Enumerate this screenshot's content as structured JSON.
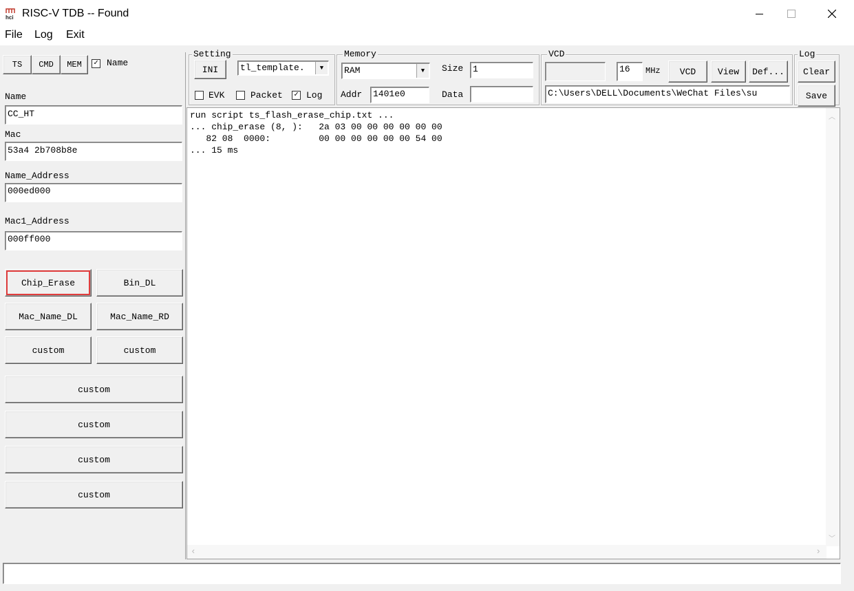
{
  "window": {
    "title": "RISC-V TDB -- Found",
    "app_icon_text": "hci"
  },
  "menu": {
    "file": "File",
    "log": "Log",
    "exit": "Exit"
  },
  "left": {
    "tabs": {
      "ts": "TS",
      "cmd": "CMD",
      "mem": "MEM"
    },
    "name_check_label": "Name",
    "name_label": "Name",
    "name_value": "CC_HT",
    "mac_label": "Mac",
    "mac_value": "53a4 2b708b8e",
    "name_address_label": "Name_Address",
    "name_address_value": "000ed000",
    "mac1_address_label": "Mac1_Address",
    "mac1_address_value": "000ff000",
    "buttons": {
      "chip_erase": "Chip_Erase",
      "bin_dl": "Bin_DL",
      "mac_name_dl": "Mac_Name_DL",
      "mac_name_rd": "Mac_Name_RD",
      "custom_1": "custom",
      "custom_2": "custom",
      "custom_3": "custom",
      "custom_4": "custom",
      "custom_5": "custom",
      "custom_6": "custom"
    }
  },
  "setting": {
    "title": "Setting",
    "ini": "INI",
    "template": "tl_template.",
    "evk": "EVK",
    "packet": "Packet",
    "log": "Log"
  },
  "memory": {
    "title": "Memory",
    "type": "RAM",
    "size_label": "Size",
    "size_value": "1",
    "addr_label": "Addr",
    "addr_value": "1401e0",
    "data_label": "Data",
    "data_value": ""
  },
  "vcd": {
    "title": "VCD",
    "freq": "16",
    "unit": "MHz",
    "vcd_btn": "VCD",
    "view_btn": "View",
    "def_btn": "Def...",
    "path": "C:\\Users\\DELL\\Documents\\WeChat Files\\su"
  },
  "log_group": {
    "title": "Log",
    "clear": "Clear",
    "save": "Save"
  },
  "log_lines": [
    "run script ts_flash_erase_chip.txt ...",
    "... chip_erase (8, ):   2a 03 00 00 00 00 00 00",
    "   82 08  0000:         00 00 00 00 00 00 54 00",
    "... 15 ms"
  ],
  "status": {
    "value": ""
  },
  "colors": {
    "highlight": "#e03c3c"
  }
}
